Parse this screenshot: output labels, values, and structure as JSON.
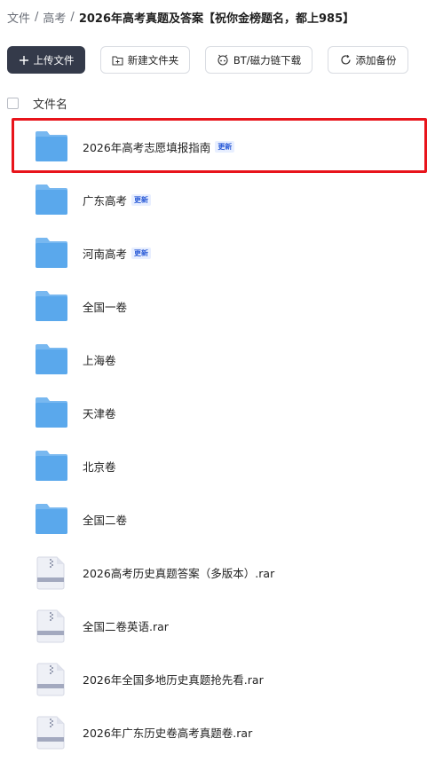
{
  "breadcrumb": {
    "root": "文件",
    "parent": "高考",
    "separator": "/",
    "current": "2026年高考真题及答案【祝你金榜题名，都上985】"
  },
  "toolbar": {
    "upload_label": "上传文件",
    "new_folder_label": "新建文件夹",
    "bt_label": "BT/磁力链下载",
    "backup_label": "添加备份"
  },
  "list_header": {
    "name_label": "文件名"
  },
  "badge_label": "更新",
  "files": [
    {
      "name": "2026年高考志愿填报指南",
      "type": "folder",
      "badge": true,
      "highlighted": true
    },
    {
      "name": "广东高考",
      "type": "folder",
      "badge": true
    },
    {
      "name": "河南高考",
      "type": "folder",
      "badge": true
    },
    {
      "name": "全国一卷",
      "type": "folder",
      "badge": false
    },
    {
      "name": "上海卷",
      "type": "folder",
      "badge": false
    },
    {
      "name": "天津卷",
      "type": "folder",
      "badge": false
    },
    {
      "name": "北京卷",
      "type": "folder",
      "badge": false
    },
    {
      "name": "全国二卷",
      "type": "folder",
      "badge": false
    },
    {
      "name": "2026高考历史真题答案（多版本）.rar",
      "type": "archive",
      "badge": false
    },
    {
      "name": "全国二卷英语.rar",
      "type": "archive",
      "badge": false
    },
    {
      "name": "2026年全国多地历史真题抢先看.rar",
      "type": "archive",
      "badge": false
    },
    {
      "name": "2026年广东历史卷高考真题卷.rar",
      "type": "archive",
      "badge": false
    }
  ],
  "colors": {
    "primary_button": "#343a4a",
    "folder": "#5aa8ec",
    "highlight_border": "#e8141b",
    "badge_text": "#2a5bd7"
  },
  "icons": {
    "upload": "plus-icon",
    "new_folder": "new-folder-icon",
    "bt": "bt-download-icon",
    "backup": "backup-refresh-icon",
    "folder": "folder-icon",
    "archive": "archive-file-icon"
  }
}
